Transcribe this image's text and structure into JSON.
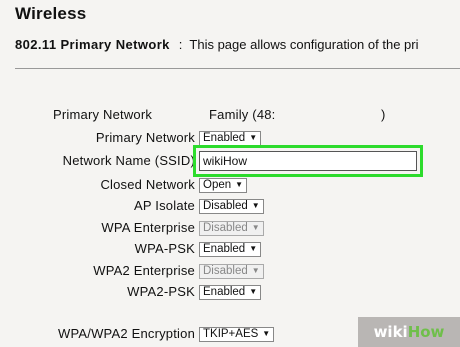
{
  "page": {
    "title": "Wireless",
    "section_name": "802.11 Primary Network",
    "section_separator": ":",
    "section_description": "This page allows configuration of the pri"
  },
  "primary_network_info": {
    "label": "Primary Network",
    "value": "Family (48:",
    "value_end": ")"
  },
  "fields": {
    "primary_network": {
      "label": "Primary Network",
      "value": "Enabled"
    },
    "ssid": {
      "label": "Network Name (SSID)",
      "value": "wikiHow"
    },
    "closed_network": {
      "label": "Closed Network",
      "value": "Open"
    },
    "ap_isolate": {
      "label": "AP Isolate",
      "value": "Disabled"
    },
    "wpa_enterprise": {
      "label": "WPA Enterprise",
      "value": "Disabled"
    },
    "wpa_psk": {
      "label": "WPA-PSK",
      "value": "Enabled"
    },
    "wpa2_enterprise": {
      "label": "WPA2 Enterprise",
      "value": "Disabled"
    },
    "wpa2_psk": {
      "label": "WPA2-PSK",
      "value": "Enabled"
    },
    "encryption": {
      "label": "WPA/WPA2 Encryption",
      "value": "TKIP+AES"
    }
  },
  "watermark": {
    "prefix": "wiki",
    "brand": "How"
  },
  "colors": {
    "highlight": "#2cdb2c",
    "watermark_bg": "#b9b6b4",
    "watermark_brand": "#6fbf4a"
  }
}
